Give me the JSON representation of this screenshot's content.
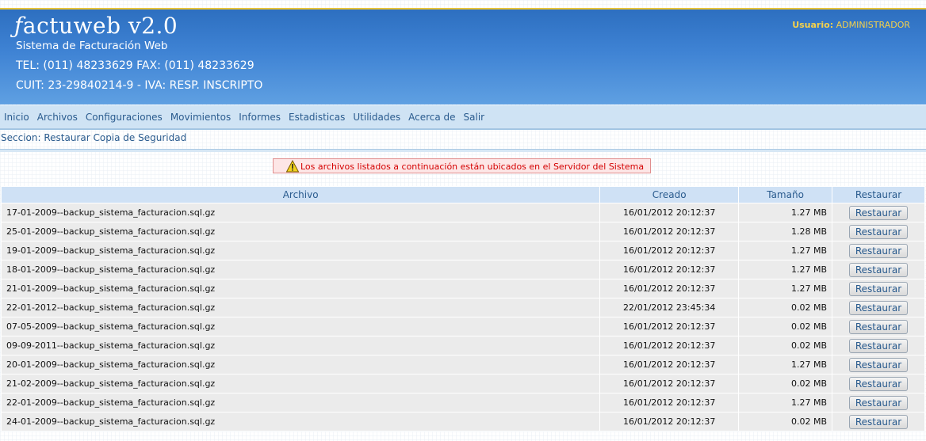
{
  "header": {
    "logo_initial": "ƒ",
    "logo_text": "actuweb v2.0",
    "tagline": "Sistema de Facturación Web",
    "tel": "TEL: (011) 48233629 FAX: (011) 48233629",
    "cuit": "CUIT: 23-29840214-9 - IVA: RESP. INSCRIPTO",
    "user_label": "Usuario:",
    "user_name": "ADMINISTRADOR"
  },
  "menu": [
    "Inicio",
    "Archivos",
    "Configuraciones",
    "Movimientos",
    "Informes",
    "Estadisticas",
    "Utilidades",
    "Acerca de",
    "Salir"
  ],
  "section": "Seccion: Restaurar Copia de Seguridad",
  "warning": "Los archivos listados a continuación están ubicados en el Servidor del Sistema",
  "table": {
    "headers": [
      "Archivo",
      "Creado",
      "Tamaño",
      "Restaurar"
    ],
    "button_label": "Restaurar",
    "rows": [
      [
        "17-01-2009--backup_sistema_facturacion.sql.gz",
        "16/01/2012 20:12:37",
        "1.27 MB"
      ],
      [
        "25-01-2009--backup_sistema_facturacion.sql.gz",
        "16/01/2012 20:12:37",
        "1.28 MB"
      ],
      [
        "19-01-2009--backup_sistema_facturacion.sql.gz",
        "16/01/2012 20:12:37",
        "1.27 MB"
      ],
      [
        "18-01-2009--backup_sistema_facturacion.sql.gz",
        "16/01/2012 20:12:37",
        "1.27 MB"
      ],
      [
        "21-01-2009--backup_sistema_facturacion.sql.gz",
        "16/01/2012 20:12:37",
        "1.27 MB"
      ],
      [
        "22-01-2012--backup_sistema_facturacion.sql.gz",
        "22/01/2012 23:45:34",
        "0.02 MB"
      ],
      [
        "07-05-2009--backup_sistema_facturacion.sql.gz",
        "16/01/2012 20:12:37",
        "0.02 MB"
      ],
      [
        "09-09-2011--backup_sistema_facturacion.sql.gz",
        "16/01/2012 20:12:37",
        "0.02 MB"
      ],
      [
        "20-01-2009--backup_sistema_facturacion.sql.gz",
        "16/01/2012 20:12:37",
        "1.27 MB"
      ],
      [
        "21-02-2009--backup_sistema_facturacion.sql.gz",
        "16/01/2012 20:12:37",
        "0.02 MB"
      ],
      [
        "22-01-2009--backup_sistema_facturacion.sql.gz",
        "16/01/2012 20:12:37",
        "1.27 MB"
      ],
      [
        "24-01-2009--backup_sistema_facturacion.sql.gz",
        "16/01/2012 20:12:37",
        "0.02 MB"
      ]
    ]
  },
  "icons": {
    "warning": "warning-triangle-icon"
  },
  "colors": {
    "header_blue": "#3f83d4",
    "user_gold": "#f5d14b",
    "warn_red": "#d40000",
    "link_blue": "#2a5b8e"
  }
}
